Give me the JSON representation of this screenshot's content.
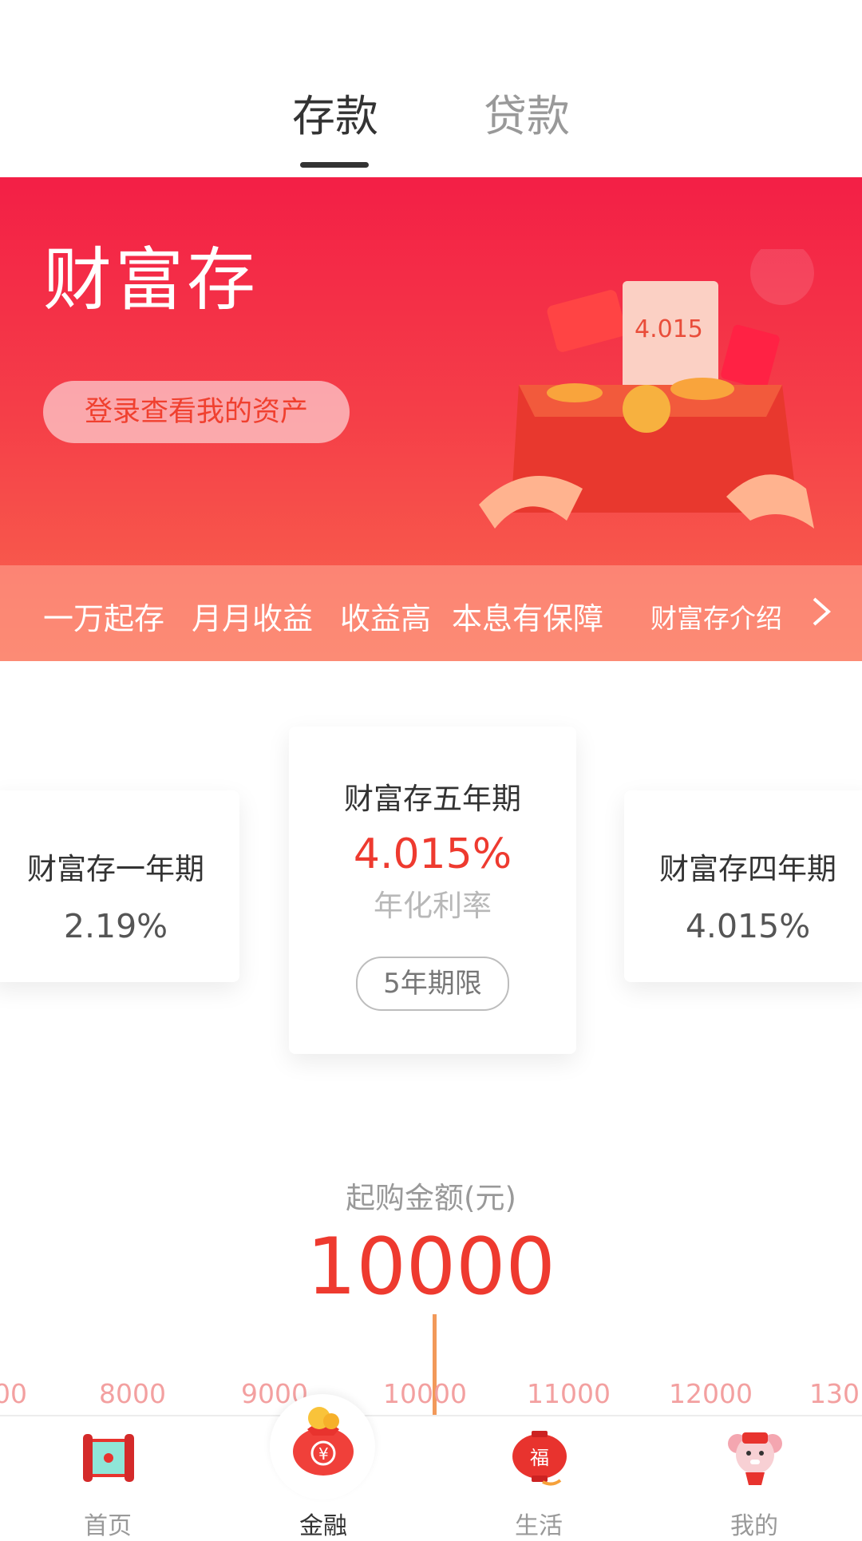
{
  "tabs": {
    "deposit": "存款",
    "loan": "贷款"
  },
  "banner": {
    "title": "财富存",
    "login_button": "登录查看我的资产",
    "features": [
      "一万起存",
      "月月收益",
      "收益高",
      "本息有保障"
    ],
    "intro_link": "财富存介绍",
    "illustration_text": "4.015"
  },
  "products": {
    "left": {
      "name": "财富存一年期",
      "rate": "2.19%"
    },
    "center": {
      "name": "财富存五年期",
      "rate": "4.015%",
      "rate_label": "年化利率",
      "term": "5年期限"
    },
    "right": {
      "name": "财富存四年期",
      "rate": "4.015%"
    }
  },
  "amount": {
    "label": "起购金额(元)",
    "value": "10000",
    "ruler": [
      "00",
      "8000",
      "9000",
      "10000",
      "11000",
      "12000",
      "130"
    ]
  },
  "nav": {
    "home": "首页",
    "finance": "金融",
    "life": "生活",
    "mine": "我的",
    "active": "finance"
  },
  "colors": {
    "accent": "#ee3a2f",
    "banner_top": "#f31f46",
    "banner_bottom": "#f9674e"
  }
}
